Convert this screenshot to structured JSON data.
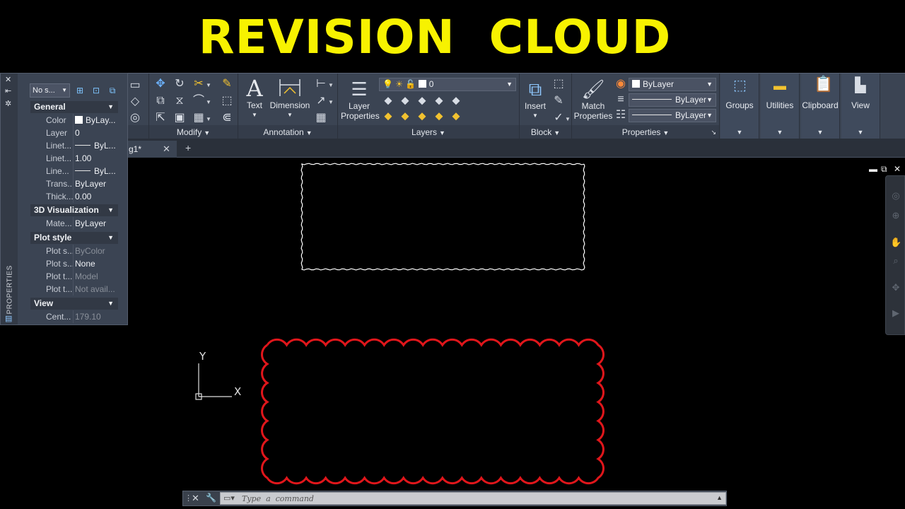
{
  "banner": {
    "title": "REVISION  CLOUD"
  },
  "ribbon": {
    "modify": {
      "footer": "Modify"
    },
    "annotation": {
      "text_label": "Text",
      "dimension_label": "Dimension",
      "footer": "Annotation"
    },
    "layers": {
      "layer_properties_line1": "Layer",
      "layer_properties_line2": "Properties",
      "current_layer": "0",
      "footer": "Layers"
    },
    "block": {
      "insert_label": "Insert",
      "footer": "Block"
    },
    "properties": {
      "match_line1": "Match",
      "match_line2": "Properties",
      "color": "ByLayer",
      "linetype": "ByLayer",
      "lineweight": "ByLayer",
      "footer": "Properties"
    },
    "groups_label": "Groups",
    "utilities_label": "Utilities",
    "clipboard_label": "Clipboard",
    "view_label": "View"
  },
  "tabs": {
    "drawing": "g1*"
  },
  "properties_palette": {
    "vertical_label": "PROPERTIES",
    "selection": "No s...",
    "sections": {
      "general": "General",
      "viz3d": "3D Visualization",
      "plot_style": "Plot style",
      "view": "View"
    },
    "general_rows": [
      {
        "k": "Color",
        "v": "ByLay..."
      },
      {
        "k": "Layer",
        "v": "0"
      },
      {
        "k": "Linet...",
        "v": "ByL..."
      },
      {
        "k": "Linet...",
        "v": "1.00"
      },
      {
        "k": "Line...",
        "v": "ByL..."
      },
      {
        "k": "Trans...",
        "v": "ByLayer"
      },
      {
        "k": "Thick...",
        "v": "0.00"
      }
    ],
    "viz_rows": [
      {
        "k": "Mate...",
        "v": "ByLayer"
      }
    ],
    "plot_rows": [
      {
        "k": "Plot s...",
        "v": "ByColor"
      },
      {
        "k": "Plot s...",
        "v": "None"
      },
      {
        "k": "Plot t...",
        "v": "Model"
      },
      {
        "k": "Plot t...",
        "v": "Not avail..."
      }
    ],
    "view_rows": [
      {
        "k": "Cent...",
        "v": "179.10"
      }
    ]
  },
  "ucs": {
    "x_label": "X",
    "y_label": "Y"
  },
  "command_line": {
    "placeholder": "Type  a  command"
  },
  "colors": {
    "banner_yellow": "#f7f200",
    "cloud_red": "#e0161b",
    "ribbon_bg": "#3b4453"
  },
  "icons": [
    "close-icon",
    "pin-icon",
    "settings-icon",
    "move-icon",
    "rotate-icon",
    "trim-icon",
    "erase-icon",
    "text-icon",
    "dimension-icon",
    "layer-properties-icon",
    "insert-icon",
    "match-properties-icon",
    "color-wheel-icon",
    "groups-icon",
    "utilities-icon",
    "clipboard-icon",
    "view-icon",
    "wrench-icon"
  ]
}
